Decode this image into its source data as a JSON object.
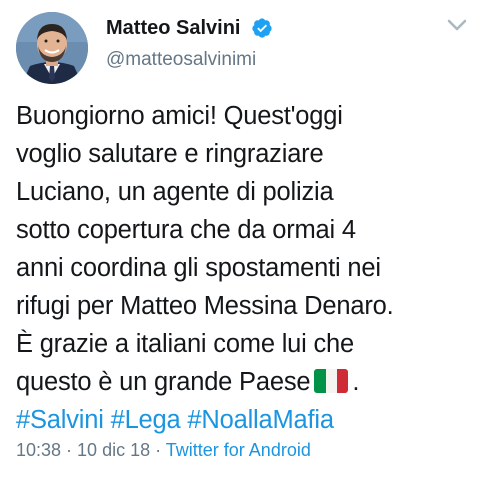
{
  "user": {
    "display_name": "Matteo Salvini",
    "handle": "@matteosalvinimi",
    "verified": true,
    "avatar_icon": "user-avatar",
    "verified_icon": "verified-badge-icon"
  },
  "menu": {
    "icon": "chevron-down-icon"
  },
  "tweet": {
    "lines": [
      "Buongiorno amici! Quest'oggi",
      "voglio salutare e ringraziare",
      "Luciano, un agente di polizia",
      "sotto copertura che da ormai 4",
      "anni coordina gli spostamenti nei",
      "rifugi per Matteo Messina Denaro.",
      "È grazie a italiani come lui che",
      "questo è un grande Paese"
    ],
    "line_end": ".",
    "flag_icon": "italy-flag-icon",
    "flag_colors": [
      "#009246",
      "#ffffff",
      "#ce2b37"
    ],
    "hashtags": [
      "#Salvini",
      "#Lega",
      "#NoallaMafia"
    ]
  },
  "meta": {
    "time": "10:38",
    "separator": " · ",
    "date": "10 dic 18",
    "source": "Twitter for Android"
  },
  "colors": {
    "text": "#14171a",
    "muted": "#657786",
    "link": "#1b95e0",
    "verified": "#1da1f2"
  }
}
